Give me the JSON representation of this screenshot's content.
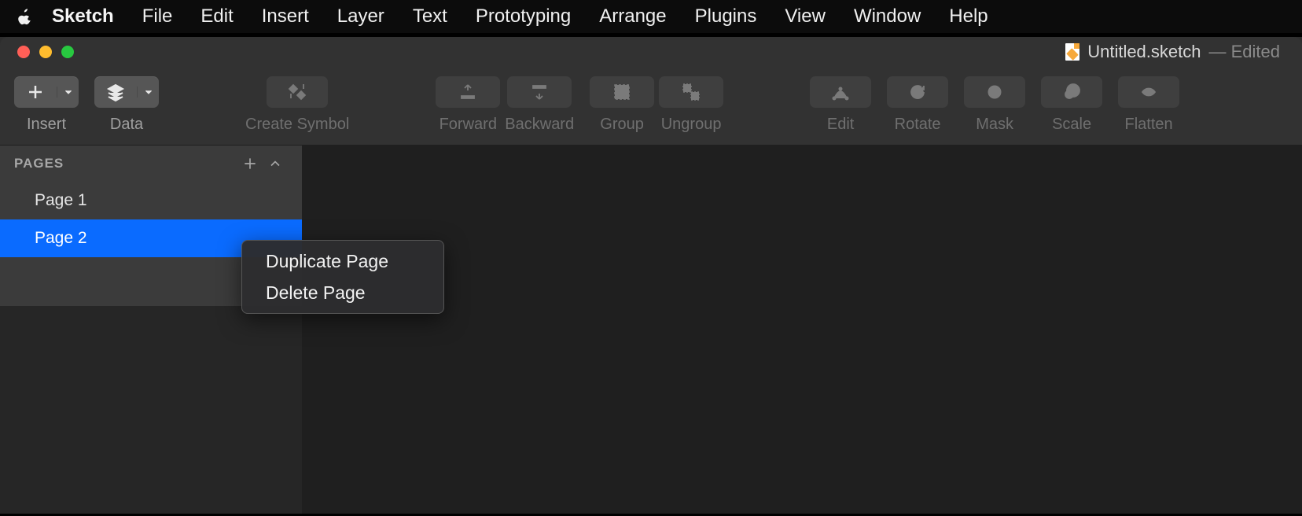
{
  "menubar": {
    "app": "Sketch",
    "items": [
      "File",
      "Edit",
      "Insert",
      "Layer",
      "Text",
      "Prototyping",
      "Arrange",
      "Plugins",
      "View",
      "Window",
      "Help"
    ]
  },
  "window": {
    "document_name": "Untitled.sketch",
    "edited_suffix": "— Edited"
  },
  "toolbar": {
    "insert": "Insert",
    "data": "Data",
    "create_symbol": "Create Symbol",
    "forward": "Forward",
    "backward": "Backward",
    "group": "Group",
    "ungroup": "Ungroup",
    "edit": "Edit",
    "rotate": "Rotate",
    "mask": "Mask",
    "scale": "Scale",
    "flatten": "Flatten"
  },
  "sidebar": {
    "pages_title": "PAGES",
    "pages": [
      "Page 1",
      "Page 2"
    ],
    "selected_index": 1
  },
  "context_menu": {
    "items": [
      "Duplicate Page",
      "Delete Page"
    ]
  }
}
